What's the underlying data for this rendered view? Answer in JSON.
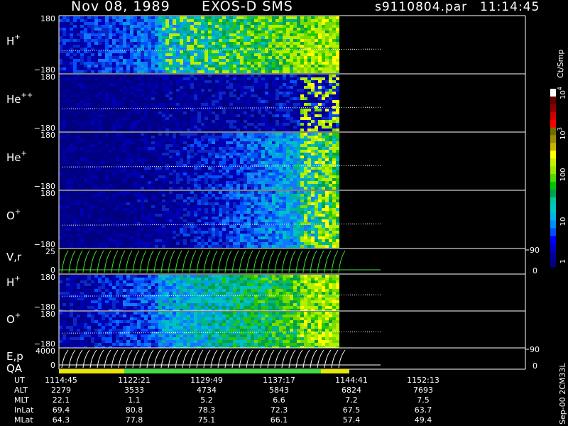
{
  "header": {
    "date": "Nov 08, 1989",
    "instrument": "EXOS-D SMS",
    "file": "s9110804.par",
    "time": "11:14:45"
  },
  "colorbar": {
    "title": "Ct/Smp",
    "ticks": [
      "1",
      "10",
      "100",
      "10",
      "10"
    ],
    "tick_exponents": [
      "",
      "",
      "",
      "3",
      "4"
    ],
    "colors": [
      "#000080",
      "#0000a0",
      "#0000c8",
      "#0000ff",
      "#0050ff",
      "#008cff",
      "#00b4e6",
      "#00c8c8",
      "#00c8a0",
      "#00a050",
      "#00c800",
      "#50dc00",
      "#a0e600",
      "#c8f000",
      "#ffff00",
      "#c8b400",
      "#a08c00",
      "#6e6e00",
      "#ff0000",
      "#c80000",
      "#8c0000",
      "#640000",
      "#ffffff"
    ]
  },
  "footer_text": "Sep-00 2CM33L",
  "time_axis": {
    "rows": [
      {
        "label": "UT",
        "values": [
          "1114:45",
          "1122:21",
          "1129:49",
          "1137:17",
          "1144:41",
          "1152:13"
        ]
      },
      {
        "label": "ALT",
        "values": [
          "2279",
          "3533",
          "4734",
          "5843",
          "6824",
          "7693"
        ]
      },
      {
        "label": "MLT",
        "values": [
          "22.1",
          "1.1",
          "5.2",
          "6.6",
          "7.2",
          "7.5"
        ]
      },
      {
        "label": "InLat",
        "values": [
          "69.4",
          "80.8",
          "78.3",
          "72.3",
          "67.5",
          "63.7"
        ]
      },
      {
        "label": "MLat",
        "values": [
          "64.3",
          "77.8",
          "75.1",
          "66.1",
          "57.4",
          "49.4"
        ]
      }
    ]
  },
  "chart_data": {
    "type": "heatmap",
    "panels": [
      {
        "label": "H",
        "superscript": "+",
        "ytop": "180",
        "ybot": "−180",
        "ylim": [
          -180,
          180
        ],
        "style": "spectrogram"
      },
      {
        "label": "He",
        "superscript": "++",
        "ytop": "180",
        "ybot": "−180",
        "ylim": [
          -180,
          180
        ],
        "style": "spectrogram"
      },
      {
        "label": "He",
        "superscript": "+",
        "ytop": "180",
        "ybot": "−180",
        "ylim": [
          -180,
          180
        ],
        "style": "spectrogram"
      },
      {
        "label": "O",
        "superscript": "+",
        "ytop": "180",
        "ybot": "−180",
        "ylim": [
          -180,
          180
        ],
        "style": "spectrogram"
      },
      {
        "label": "V,r",
        "superscript": "",
        "ytop": "25",
        "ybot": "0",
        "ylim": [
          0,
          25
        ],
        "style": "sweep",
        "right_top": "90",
        "right_bot": "0"
      },
      {
        "label": "H",
        "superscript": "+",
        "ytop": "180",
        "ybot": "−180",
        "ylim": [
          -180,
          180
        ],
        "style": "spectrogram"
      },
      {
        "label": "O",
        "superscript": "+",
        "ytop": "180",
        "ybot": "−180",
        "ylim": [
          -180,
          180
        ],
        "style": "spectrogram"
      },
      {
        "label": "E,p",
        "label2": "QA",
        "superscript": "",
        "ytop": "4000",
        "ybot": "0",
        "ylim": [
          0,
          4000
        ],
        "style": "sweep",
        "right_top": "90",
        "right_bot": "0"
      }
    ],
    "x_ticks": [
      "1114:45",
      "1122:21",
      "1129:49",
      "1137:17",
      "1144:41",
      "1152:13"
    ],
    "data_end_fraction": 0.6
  }
}
